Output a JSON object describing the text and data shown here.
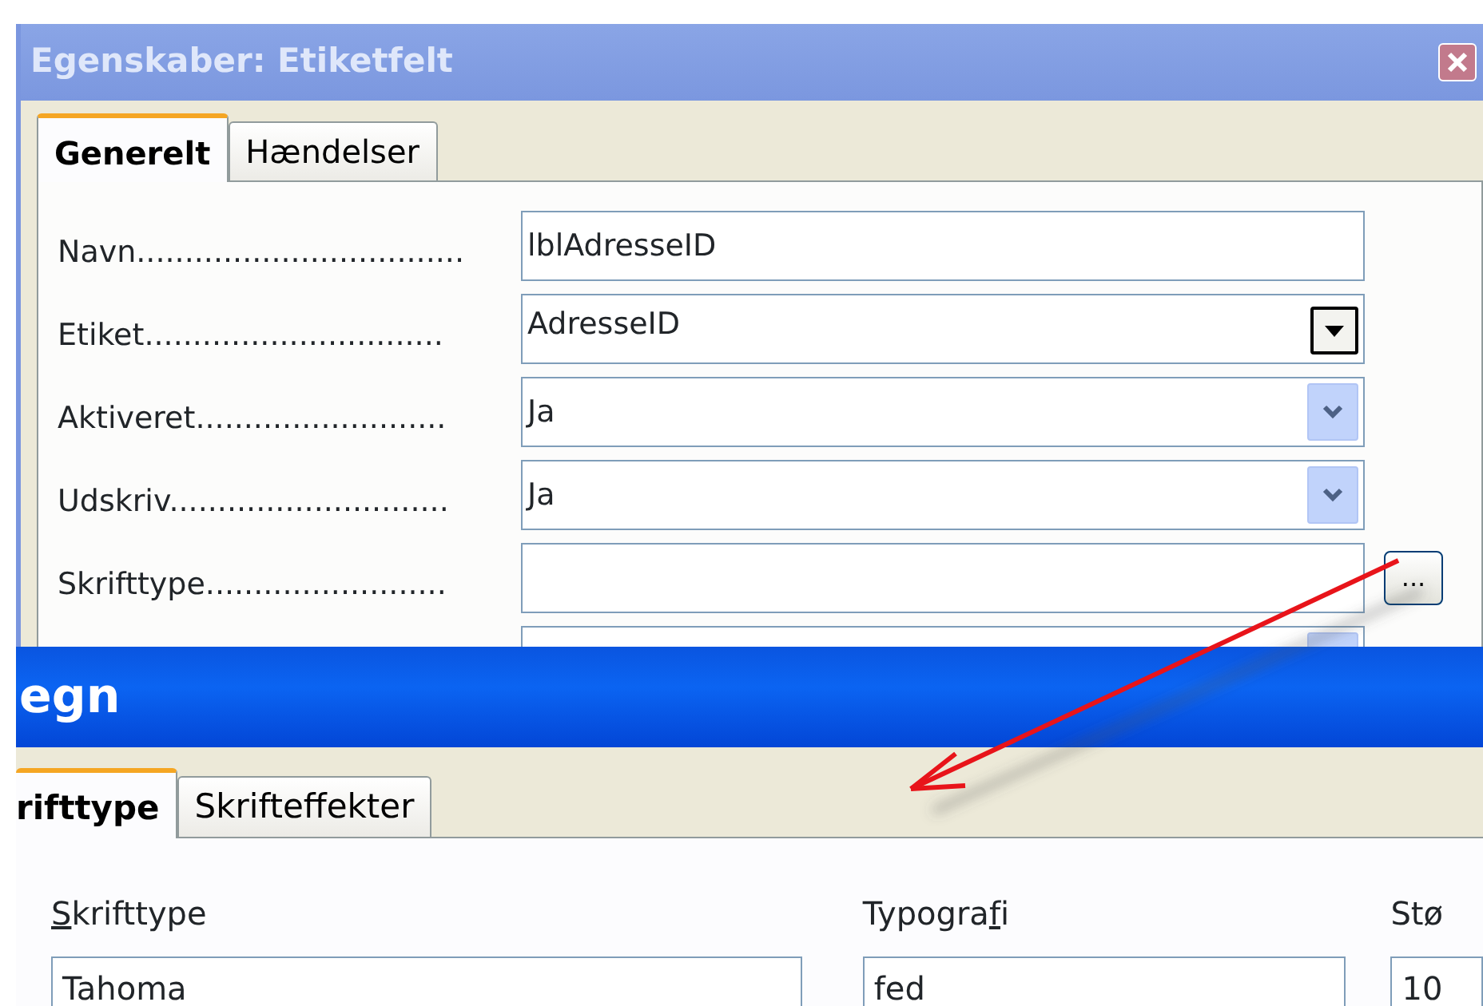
{
  "properties_window": {
    "title": "Egenskaber: Etiketfelt",
    "tabs": [
      {
        "label": "Generelt",
        "selected": true
      },
      {
        "label": "Hændelser",
        "selected": false
      }
    ],
    "rows": [
      {
        "kind": "text",
        "label": "Navn..................................",
        "value": "lblAdresseID"
      },
      {
        "kind": "combo",
        "label": "Etiket...............................",
        "value": "AdresseID",
        "focused": true
      },
      {
        "kind": "dropdown",
        "label": "Aktiveret..........................",
        "value": "Ja",
        "focused": false
      },
      {
        "kind": "dropdown",
        "label": "Udskriv.............................",
        "value": "Ja",
        "focused": false
      },
      {
        "kind": "browse",
        "label": "Skrifttype.........................",
        "button": "..."
      },
      {
        "kind": "dropdown",
        "focused": false
      }
    ]
  },
  "font_window": {
    "title": "egn",
    "tabs": [
      {
        "label": "rifttype",
        "selected": true
      },
      {
        "label": "Skrifteffekter",
        "selected": false
      }
    ],
    "fields": [
      {
        "label_parts": [
          {
            "text": "S",
            "underlined": true
          },
          {
            "text": "krifttype",
            "underlined": false
          }
        ],
        "value": "Tahoma"
      },
      {
        "label_parts": [
          {
            "text": "Typogra",
            "underlined": false
          },
          {
            "text": "f",
            "underlined": true
          },
          {
            "text": "i",
            "underlined": false
          }
        ],
        "value": "fed"
      },
      {
        "label_parts": [
          {
            "text": "Stø",
            "underlined": false
          }
        ],
        "value": "10"
      }
    ]
  }
}
